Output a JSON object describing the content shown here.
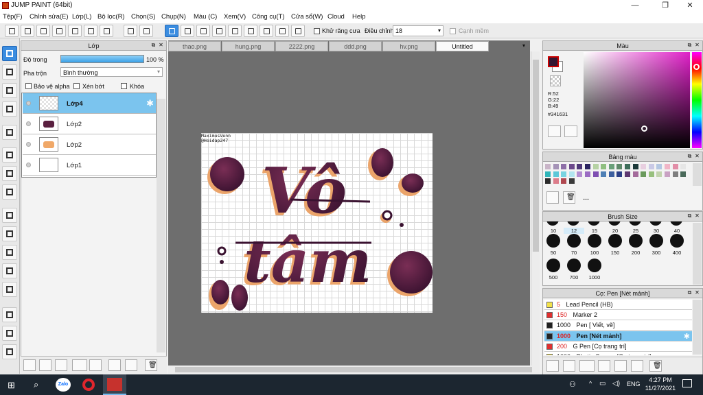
{
  "window": {
    "title": "JUMP PAINT (64bit)",
    "min": "—",
    "max": "❐",
    "close": "✕"
  },
  "menu": [
    "Tệp(F)",
    "Chỉnh sửa(E)",
    "Lớp(L)",
    "Bộ lọc(R)",
    "Chọn(S)",
    "Chụp(N)",
    "Màu (C)",
    "Xem(V)",
    "Công cụ(T)",
    "Cửa sổ(W)",
    "Cloud",
    "Help"
  ],
  "toolbar": {
    "antialias": "Khử răng cưa",
    "adjust": "Điều chỉnh",
    "adjust_value": "18",
    "smooth": "Cạnh mềm"
  },
  "layer_panel": {
    "title": "Lớp",
    "opacity_label": "Độ trong",
    "opacity_value": "100 %",
    "opacity": 1.0,
    "blend_label": "Pha trộn",
    "blend_value": "Bình thường",
    "protect_alpha": "Bảo vệ alpha",
    "clip": "Xén bớt",
    "lock": "Khóa",
    "layers": [
      {
        "name": "Lớp4",
        "selected": true
      },
      {
        "name": "Lớp2",
        "selected": false
      },
      {
        "name": "Lớp2",
        "selected": false
      },
      {
        "name": "Lớp1",
        "selected": false
      }
    ]
  },
  "tabs": [
    {
      "name": "thao.png",
      "active": false
    },
    {
      "name": "hung.png",
      "active": false
    },
    {
      "name": "2222.png",
      "active": false
    },
    {
      "name": "ddd.png",
      "active": false
    },
    {
      "name": "hv.png",
      "active": false
    },
    {
      "name": "Untitled",
      "active": true
    }
  ],
  "canvas": {
    "watermark_1": "MaximusVenn",
    "watermark_2": "@Hoidap247",
    "art_line_1": "Vô",
    "art_line_2": "tâm"
  },
  "color_panel": {
    "title": "Màu",
    "r": "R:52",
    "g": "G:22",
    "b": "B:49",
    "hex": "#341631",
    "current": "#341631"
  },
  "palette": {
    "title": "Bảng màu",
    "dash": "---",
    "colors": [
      "#c9b5c8",
      "#a593b7",
      "#8e6fa8",
      "#6c4a8c",
      "#4e3878",
      "#2b2460",
      "#b6d2a4",
      "#8fbf80",
      "#6aa07a",
      "#5f8a6b",
      "#3e6e5a",
      "#1c3a3a",
      "#e8cfe0",
      "#c9c9e6",
      "#b4c7e2",
      "#f1b5c7",
      "#e28ea8",
      "#e6e6e6",
      "#2fb5b9",
      "#5cc8d8",
      "#79d3e0",
      "#b1e5ef",
      "#b38ed1",
      "#9b6cc3",
      "#7f4fb2",
      "#4e7fb5",
      "#3c5e9e",
      "#2b3e86",
      "#5e3870",
      "#a46b9b",
      "#6a9a5c",
      "#98c07e",
      "#c2d3ae",
      "#c9a1c3",
      "#7e7e7e",
      "#4a6a5a",
      "#2a2a2a",
      "#dc7c8a",
      "#b04850",
      "#3a3a3a"
    ]
  },
  "brush_size": {
    "title": "Brush Size",
    "sizes": [
      "10",
      "12",
      "15",
      "20",
      "25",
      "30",
      "40",
      "50",
      "70",
      "100",
      "150",
      "200",
      "300",
      "400",
      "500",
      "700",
      "1000"
    ]
  },
  "brush_list": {
    "title": "Cọ: Pen [Nét mảnh]",
    "items": [
      {
        "size": "5",
        "name": "Lead Pencil (HB)",
        "color": "#f2e14a",
        "selected": false
      },
      {
        "size": "150",
        "name": "Marker 2",
        "color": "#e03030",
        "selected": false
      },
      {
        "size": "1000",
        "name": "Pen [ Viết, vẽ]",
        "color": "#222222",
        "selected": false
      },
      {
        "size": "1000",
        "name": "Pen [Nét mảnh]",
        "color": "#222222",
        "selected": true
      },
      {
        "size": "200",
        "name": "G Pen [Cọ trang trí]",
        "color": "#e03030",
        "selected": false
      },
      {
        "size": "1000",
        "name": "Photic Crayon [Cọ trang trí]",
        "color": "#f2e14a",
        "selected": false
      }
    ]
  },
  "taskbar": {
    "time": "4:27 PM",
    "date": "11/27/2021",
    "lang": "ENG",
    "zalo": "Zalo"
  }
}
